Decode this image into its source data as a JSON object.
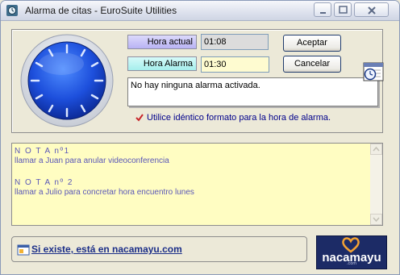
{
  "window": {
    "title": "Alarma de citas - EuroSuite Utilities",
    "icons": {
      "app": "alarm-clock-icon",
      "minimize": "minimize-icon",
      "maximize": "maximize-icon",
      "close": "close-icon"
    }
  },
  "clock": {
    "hands": "none",
    "icon": "clock-face-icon"
  },
  "time": {
    "actual_label": "Hora actual",
    "actual_value": "01:08",
    "alarm_label": "Hora Alarma",
    "alarm_value": "01:30"
  },
  "buttons": {
    "accept": "Aceptar",
    "cancel": "Cancelar"
  },
  "status": {
    "message": "No hay ninguna alarma activada."
  },
  "hint": {
    "text": "Utilice idéntico formato para la hora de alarma.",
    "icon": "checkmark-icon"
  },
  "notes": [
    {
      "heading": "N O T A  nº1",
      "body": "llamar a Juan para anular videoconferencia"
    },
    {
      "heading": "N O T A  nº 2",
      "body": "llamar a Julio para concretar hora encuentro lunes"
    }
  ],
  "footer": {
    "link_text": "Si existe, está en nacamayu.com",
    "logo_text": "nacamayu",
    "logo_sub": ".com"
  },
  "colors": {
    "label_actual": "#b9b3f4",
    "label_alarm": "#a5eeec",
    "notes_bg": "#fffdc2",
    "notes_text": "#5a57b8",
    "hint_text": "#00008b",
    "logo_bg": "#1c2b66"
  }
}
